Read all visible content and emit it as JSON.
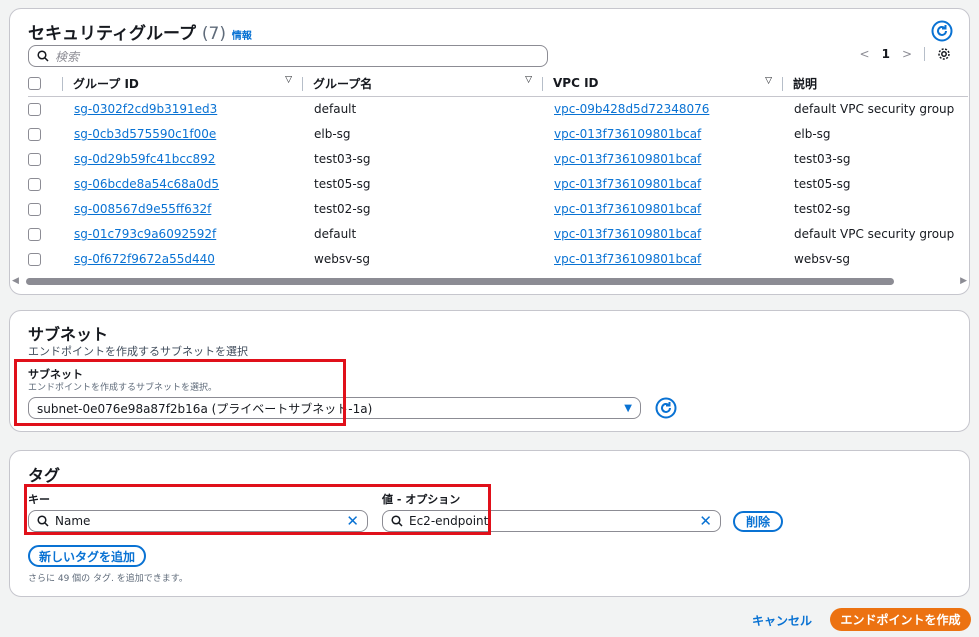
{
  "sg_panel": {
    "title": "セキュリティグループ",
    "count": "(7)",
    "info": "情報",
    "search_placeholder": "検索",
    "page": "1",
    "columns": {
      "id": "グループ ID",
      "name": "グループ名",
      "vpc": "VPC ID",
      "desc": "説明"
    },
    "rows": [
      {
        "id": "sg-0302f2cd9b3191ed3",
        "name": "default",
        "vpc": "vpc-09b428d5d72348076",
        "desc": "default VPC security group"
      },
      {
        "id": "sg-0cb3d575590c1f00e",
        "name": "elb-sg",
        "vpc": "vpc-013f736109801bcaf",
        "desc": "elb-sg"
      },
      {
        "id": "sg-0d29b59fc41bcc892",
        "name": "test03-sg",
        "vpc": "vpc-013f736109801bcaf",
        "desc": "test03-sg"
      },
      {
        "id": "sg-06bcde8a54c68a0d5",
        "name": "test05-sg",
        "vpc": "vpc-013f736109801bcaf",
        "desc": "test05-sg"
      },
      {
        "id": "sg-008567d9e55ff632f",
        "name": "test02-sg",
        "vpc": "vpc-013f736109801bcaf",
        "desc": "test02-sg"
      },
      {
        "id": "sg-01c793c9a6092592f",
        "name": "default",
        "vpc": "vpc-013f736109801bcaf",
        "desc": "default VPC security group"
      },
      {
        "id": "sg-0f672f9672a55d440",
        "name": "websv-sg",
        "vpc": "vpc-013f736109801bcaf",
        "desc": "websv-sg"
      }
    ]
  },
  "subnet_panel": {
    "title": "サブネット",
    "description": "エンドポイントを作成するサブネットを選択",
    "field_label": "サブネット",
    "field_desc": "エンドポイントを作成するサブネットを選択。",
    "selected": "subnet-0e076e98a87f2b16a (プライベートサブネット-1a)"
  },
  "tag_panel": {
    "title": "タグ",
    "key_label": "キー",
    "value_label": "値 - オプション",
    "key_value": "Name",
    "value_value": "Ec2-endpoint",
    "remove_label": "削除",
    "add_label": "新しいタグを追加",
    "hint": "さらに 49 個の タグ. を追加できます。"
  },
  "footer": {
    "cancel": "キャンセル",
    "create": "エンドポイントを作成"
  },
  "colors": {
    "link": "#0972d3",
    "primary": "#ec7211",
    "highlight": "#e0101a"
  }
}
